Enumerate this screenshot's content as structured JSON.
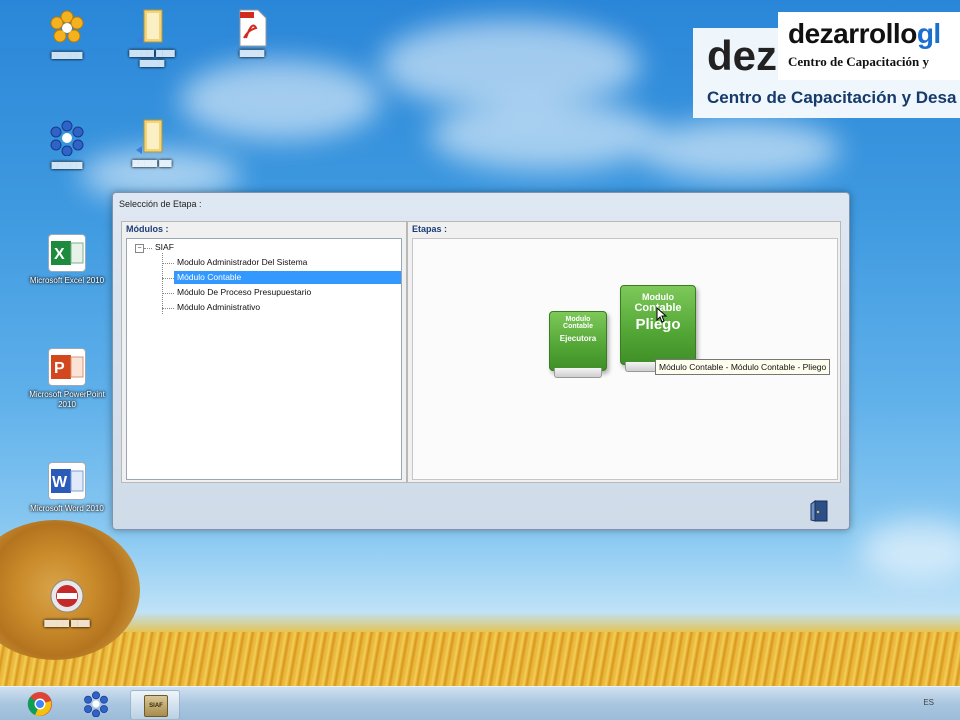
{
  "watermark": {
    "banner_brand_prefix": "dezarrollo",
    "banner_brand_suffix": "gl",
    "banner_tagline": "Centro de Capacitación y",
    "logo_prefix": "dez",
    "logo_tagline": "Centro de Capacitación y Desa"
  },
  "desktop_icons": [
    {
      "icon": "flower-app-icon"
    },
    {
      "icon": "folder-icon"
    },
    {
      "icon": "pdf-icon"
    },
    {
      "icon": "network-app-icon"
    },
    {
      "icon": "folder-icon"
    },
    {
      "icon": "excel-icon",
      "label": "Microsoft Excel 2010"
    },
    {
      "icon": "powerpoint-icon",
      "label": "Microsoft PowerPoint 2010"
    },
    {
      "icon": "word-icon",
      "label": "Microsoft Word 2010"
    },
    {
      "icon": "siaf-app-icon"
    }
  ],
  "dialog": {
    "title": "Selección de Etapa :",
    "modules_label": "Módulos :",
    "stages_label": "Etapas :",
    "tree": {
      "root": "SIAF",
      "items": [
        {
          "label": "Modulo Administrador Del Sistema",
          "selected": false
        },
        {
          "label": "Módulo Contable",
          "selected": true
        },
        {
          "label": "Módulo De Proceso Presupuestario",
          "selected": false
        },
        {
          "label": "Módulo Administrativo",
          "selected": false
        }
      ]
    },
    "stages": [
      {
        "label_line1": "Modulo",
        "label_line2": "Contable",
        "label_line3": "Ejecutora"
      },
      {
        "label_line1": "Modulo",
        "label_line2": "Contable",
        "label_line3": "Pliego"
      }
    ],
    "tooltip": "Módulo Contable - Módulo Contable - Pliego"
  },
  "taskbar": {
    "items": [
      "chrome-icon",
      "network-app-icon",
      "siaf-app-icon"
    ],
    "active_item_label": "SIAF",
    "tray_text": "ES"
  },
  "colors": {
    "selection": "#3399ff",
    "book_green": "#52a635",
    "brand_blue": "#1a6fd0"
  }
}
